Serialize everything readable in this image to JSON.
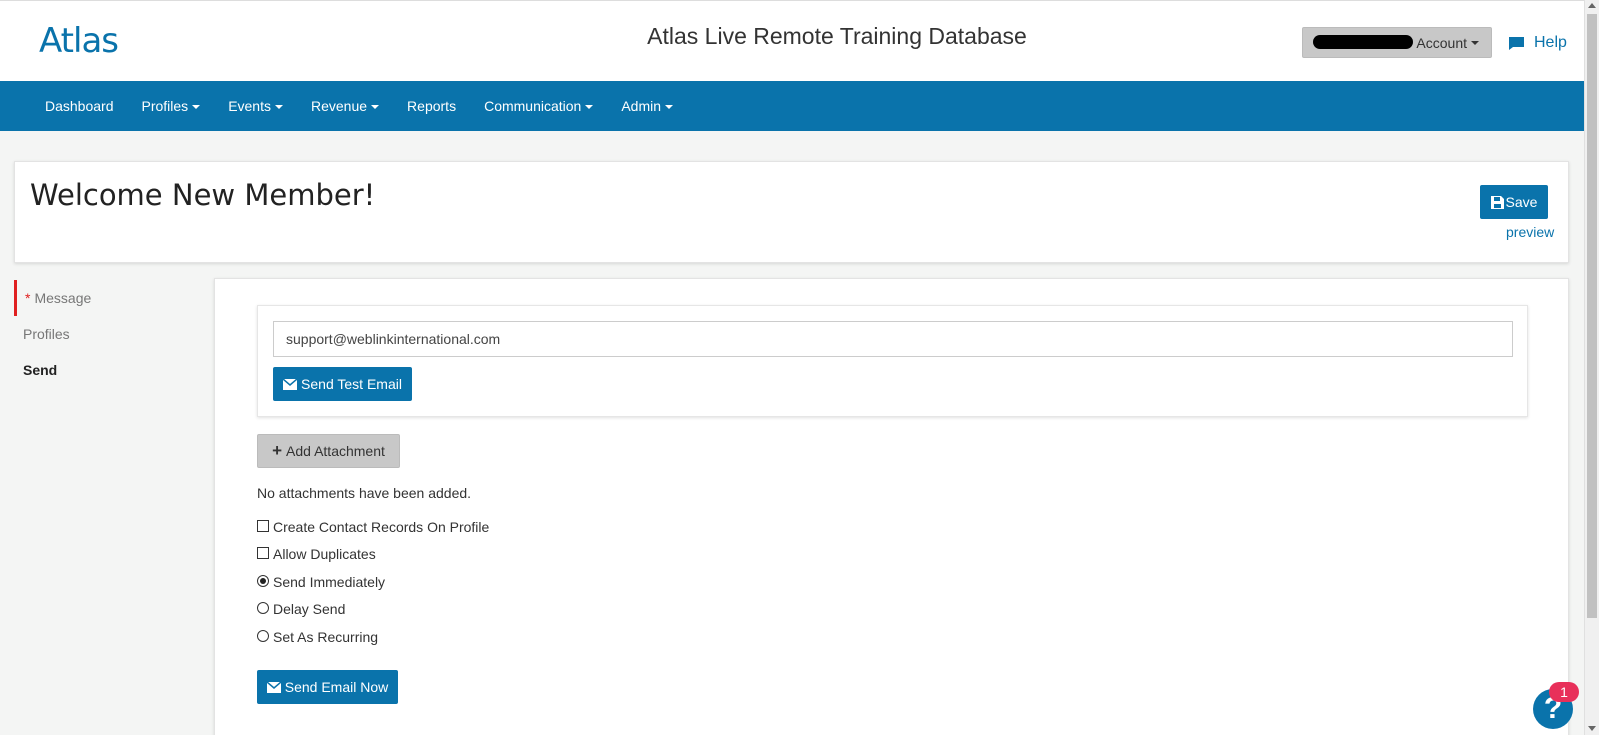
{
  "header": {
    "logo": "Atlas",
    "title": "Atlas Live Remote Training Database",
    "account_label": "Account",
    "help_label": "Help"
  },
  "nav": {
    "items": [
      {
        "label": "Dashboard",
        "dropdown": false
      },
      {
        "label": "Profiles",
        "dropdown": true
      },
      {
        "label": "Events",
        "dropdown": true
      },
      {
        "label": "Revenue",
        "dropdown": true
      },
      {
        "label": "Reports",
        "dropdown": false
      },
      {
        "label": "Communication",
        "dropdown": true
      },
      {
        "label": "Admin",
        "dropdown": true
      }
    ]
  },
  "page": {
    "title": "Welcome New Member!",
    "save_label": "Save",
    "preview_label": "preview"
  },
  "steps": [
    {
      "label": "Message",
      "required": true
    },
    {
      "label": "Profiles"
    },
    {
      "label": "Send"
    }
  ],
  "test_email": {
    "value": "support@weblinkinternational.com",
    "button_label": "Send Test Email"
  },
  "attachments": {
    "button_label": "Add Attachment",
    "empty_text": "No attachments have been added."
  },
  "options": {
    "create_contact": {
      "label": "Create Contact Records On Profile",
      "checked": false
    },
    "allow_duplicates": {
      "label": "Allow Duplicates",
      "checked": false
    },
    "send_immediately": {
      "label": "Send Immediately",
      "selected": true
    },
    "delay_send": {
      "label": "Delay Send",
      "selected": false
    },
    "recurring": {
      "label": "Set As Recurring",
      "selected": false
    }
  },
  "send_now_label": "Send Email Now",
  "help_widget": {
    "symbol": "?",
    "badge_count": "1"
  },
  "colors": {
    "brand": "#0a73ab",
    "required": "#e02020",
    "badge": "#e8305a"
  }
}
